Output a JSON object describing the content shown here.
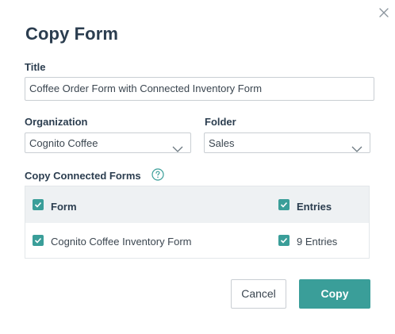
{
  "dialog": {
    "heading": "Copy Form",
    "close_icon": "close-icon"
  },
  "title_field": {
    "label": "Title",
    "value": "Coffee Order Form with Connected Inventory Form"
  },
  "organization_field": {
    "label": "Organization",
    "selected": "Cognito Coffee"
  },
  "folder_field": {
    "label": "Folder",
    "selected": "Sales"
  },
  "connected_forms": {
    "label": "Copy Connected Forms",
    "help_icon": "question-circle-icon",
    "columns": {
      "form": "Form",
      "entries": "Entries"
    },
    "header_checks": {
      "form": true,
      "entries": true
    },
    "rows": [
      {
        "form": "Cognito Coffee Inventory Form",
        "form_checked": true,
        "entries": "9 Entries",
        "entries_checked": true
      }
    ]
  },
  "buttons": {
    "cancel": "Cancel",
    "copy": "Copy"
  },
  "colors": {
    "accent": "#3a9e99",
    "heading": "#2b3d4f",
    "border": "#c9ced3",
    "table_header_bg": "#eef1f3"
  }
}
